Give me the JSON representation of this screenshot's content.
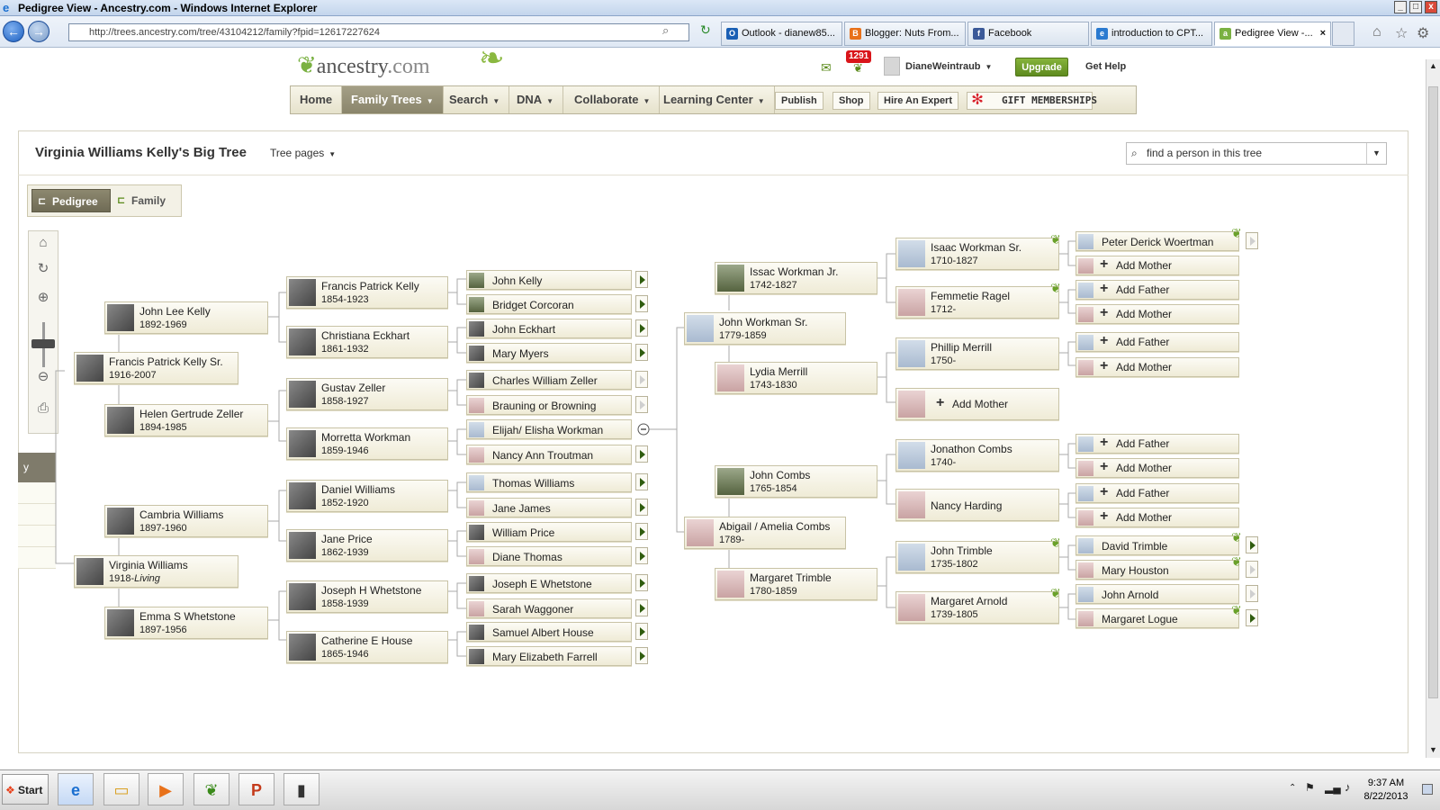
{
  "window": {
    "title": "Pedigree View - Ancestry.com - Windows Internet Explorer"
  },
  "browser": {
    "url": "http://trees.ancestry.com/tree/43104212/family?fpid=12617227624",
    "tabs": [
      {
        "label": "Outlook - dianew85...",
        "color": "#1a5fb4",
        "glyph": "O"
      },
      {
        "label": "Blogger: Nuts From...",
        "color": "#e8711a",
        "glyph": "B"
      },
      {
        "label": "Facebook",
        "color": "#3b5998",
        "glyph": "f"
      },
      {
        "label": "introduction to CPT...",
        "color": "#2a7ad0",
        "glyph": "e"
      },
      {
        "label": "Pedigree View -...",
        "color": "#7ab142",
        "glyph": "a"
      }
    ]
  },
  "header": {
    "logo": "ancestry",
    "logo_suffix": ".com",
    "notifications": "1291",
    "user": "DianeWeintraub",
    "upgrade": "Upgrade",
    "help": "Get Help"
  },
  "nav": {
    "items": [
      "Home",
      "Family Trees",
      "Search",
      "DNA",
      "Collaborate",
      "Learning Center"
    ],
    "buttons": [
      "Publish",
      "Shop",
      "Hire An Expert"
    ],
    "gift": "GIFT MEMBERSHIPS"
  },
  "tree": {
    "title": "Virginia Williams Kelly's Big Tree",
    "pages_label": "Tree pages",
    "search_placeholder": "find a person in this tree",
    "view_pedigree": "Pedigree",
    "view_family": "Family",
    "side_header": "y"
  },
  "people": {
    "p1": {
      "name": "Virginia Williams",
      "dates": "1918-",
      "living": "Living"
    },
    "p2": {
      "name": "Francis Patrick Kelly Sr.",
      "dates": "1916-2007"
    },
    "p3": {
      "name": "John Lee Kelly",
      "dates": "1892-1969"
    },
    "p4": {
      "name": "Helen Gertrude Zeller",
      "dates": "1894-1985"
    },
    "p5": {
      "name": "Cambria Williams",
      "dates": "1897-1960"
    },
    "p6": {
      "name": "Emma S Whetstone",
      "dates": "1897-1956"
    },
    "g1": {
      "name": "Francis Patrick Kelly",
      "dates": "1854-1923"
    },
    "g2": {
      "name": "Christiana Eckhart",
      "dates": "1861-1932"
    },
    "g3": {
      "name": "Gustav Zeller",
      "dates": "1858-1927"
    },
    "g4": {
      "name": "Morretta Workman",
      "dates": "1859-1946"
    },
    "g5": {
      "name": "Daniel Williams",
      "dates": "1852-1920"
    },
    "g6": {
      "name": "Jane Price",
      "dates": "1862-1939"
    },
    "g7": {
      "name": "Joseph H Whetstone",
      "dates": "1858-1939"
    },
    "g8": {
      "name": "Catherine E House",
      "dates": "1865-1946"
    },
    "s1": "John Kelly",
    "s2": "Bridget Corcoran",
    "s3": "John Eckhart",
    "s4": "Mary Myers",
    "s5": "Charles William Zeller",
    "s6": "Brauning or Browning",
    "s7": "Elijah/ Elisha Workman",
    "s8": "Nancy Ann Troutman",
    "s9": "Thomas Williams",
    "s10": "Jane James",
    "s11": "William Price",
    "s12": "Diane Thomas",
    "s13": "Joseph E Whetstone",
    "s14": "Sarah Waggoner",
    "s15": "Samuel Albert House",
    "s16": "Mary Elizabeth Farrell",
    "r1": {
      "name": "John Workman Sr.",
      "dates": "1779-1859"
    },
    "r2": {
      "name": "Abigail / Amelia Combs",
      "dates": "1789-"
    },
    "r3": {
      "name": "Issac Workman Jr.",
      "dates": "1742-1827"
    },
    "r4": {
      "name": "Lydia Merrill",
      "dates": "1743-1830"
    },
    "r5": {
      "name": "John Combs",
      "dates": "1765-1854"
    },
    "r6": {
      "name": "Margaret Trimble",
      "dates": "1780-1859"
    },
    "q1": {
      "name": "Isaac Workman Sr.",
      "dates": "1710-1827"
    },
    "q2": {
      "name": "Femmetie Ragel",
      "dates": "1712-"
    },
    "q3": {
      "name": "Phillip Merrill",
      "dates": "1750-"
    },
    "q4": {
      "name": "Jonathon Combs",
      "dates": "1740-"
    },
    "q5": {
      "name": "Nancy Harding",
      "dates": ""
    },
    "q6": {
      "name": "John Trimble",
      "dates": "1735-1802"
    },
    "q7": {
      "name": "Margaret Arnold",
      "dates": "1739-1805"
    },
    "z1": "Peter Derick Woertman",
    "z2": "David Trimble",
    "z3": "Mary Houston",
    "z4": "John Arnold",
    "z5": "Margaret Logue",
    "add_father": "Add Father",
    "add_mother": "Add Mother"
  },
  "taskbar": {
    "start": "Start",
    "time": "9:37 AM",
    "date": "8/22/2013"
  }
}
